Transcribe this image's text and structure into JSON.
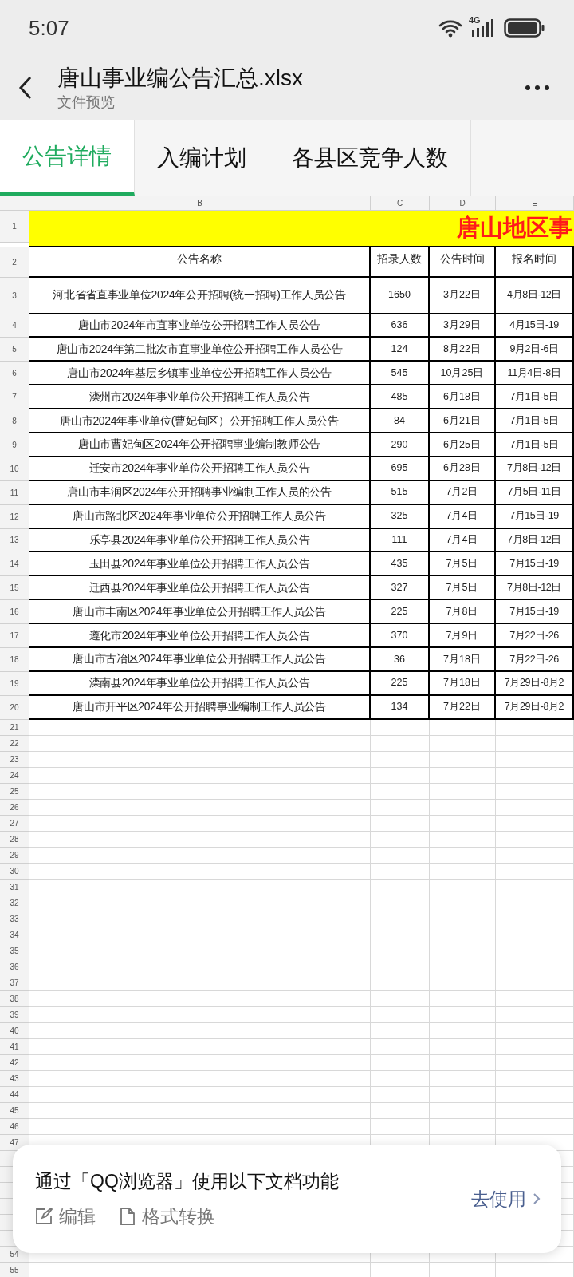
{
  "status_bar": {
    "time": "5:07",
    "network": "4G"
  },
  "header": {
    "title": "唐山事业编公告汇总.xlsx",
    "subtitle": "文件预览"
  },
  "tabs": [
    {
      "label": "公告详情",
      "selected": true
    },
    {
      "label": "入编计划",
      "selected": false
    },
    {
      "label": "各县区竞争人数",
      "selected": false
    }
  ],
  "sheet": {
    "columns": [
      "B",
      "C",
      "D",
      "E"
    ],
    "banner": "唐山地区事",
    "headings": [
      "公告名称",
      "招录人数",
      "公告时间",
      "报名时间"
    ],
    "rows": [
      {
        "number": "3",
        "cells": [
          "河北省省直事业单位2024年公开招聘(统一招聘)工作人员公告",
          "1650",
          "3月22日",
          "4月8日-12日"
        ]
      },
      {
        "number": "4",
        "cells": [
          "唐山市2024年市直事业单位公开招聘工作人员公告",
          "636",
          "3月29日",
          "4月15日-19"
        ]
      },
      {
        "number": "5",
        "cells": [
          "唐山市2024年第二批次市直事业单位公开招聘工作人员公告",
          "124",
          "8月22日",
          "9月2日-6日"
        ]
      },
      {
        "number": "6",
        "cells": [
          "唐山市2024年基层乡镇事业单位公开招聘工作人员公告",
          "545",
          "10月25日",
          "11月4日-8日"
        ]
      },
      {
        "number": "7",
        "cells": [
          "滦州市2024年事业单位公开招聘工作人员公告",
          "485",
          "6月18日",
          "7月1日-5日"
        ]
      },
      {
        "number": "8",
        "cells": [
          "唐山市2024年事业单位(曹妃甸区）公开招聘工作人员公告",
          "84",
          "6月21日",
          "7月1日-5日"
        ]
      },
      {
        "number": "9",
        "cells": [
          "唐山市曹妃甸区2024年公开招聘事业编制教师公告",
          "290",
          "6月25日",
          "7月1日-5日"
        ]
      },
      {
        "number": "10",
        "cells": [
          "迁安市2024年事业单位公开招聘工作人员公告",
          "695",
          "6月28日",
          "7月8日-12日"
        ]
      },
      {
        "number": "11",
        "cells": [
          "唐山市丰润区2024年公开招聘事业编制工作人员的公告",
          "515",
          "7月2日",
          "7月5日-11日"
        ]
      },
      {
        "number": "12",
        "cells": [
          "唐山市路北区2024年事业单位公开招聘工作人员公告",
          "325",
          "7月4日",
          "7月15日-19"
        ]
      },
      {
        "number": "13",
        "cells": [
          "乐亭县2024年事业单位公开招聘工作人员公告",
          "111",
          "7月4日",
          "7月8日-12日"
        ]
      },
      {
        "number": "14",
        "cells": [
          "玉田县2024年事业单位公开招聘工作人员公告",
          "435",
          "7月5日",
          "7月15日-19"
        ]
      },
      {
        "number": "15",
        "cells": [
          "迁西县2024年事业单位公开招聘工作人员公告",
          "327",
          "7月5日",
          "7月8日-12日"
        ]
      },
      {
        "number": "16",
        "cells": [
          "唐山市丰南区2024年事业单位公开招聘工作人员公告",
          "225",
          "7月8日",
          "7月15日-19"
        ]
      },
      {
        "number": "17",
        "cells": [
          "遵化市2024年事业单位公开招聘工作人员公告",
          "370",
          "7月9日",
          "7月22日-26"
        ]
      },
      {
        "number": "18",
        "cells": [
          "唐山市古冶区2024年事业单位公开招聘工作人员公告",
          "36",
          "7月18日",
          "7月22日-26"
        ]
      },
      {
        "number": "19",
        "cells": [
          "滦南县2024年事业单位公开招聘工作人员公告",
          "225",
          "7月18日",
          "7月29日-8月2"
        ]
      },
      {
        "number": "20",
        "cells": [
          "唐山市开平区2024年公开招聘事业编制工作人员公告",
          "134",
          "7月22日",
          "7月29日-8月2"
        ]
      }
    ],
    "top_row_numbers": [
      "1",
      "2"
    ],
    "empty_rows": [
      "21",
      "22",
      "23",
      "24",
      "25",
      "26",
      "27",
      "28",
      "29",
      "30",
      "31",
      "32",
      "33",
      "34",
      "35",
      "36",
      "37",
      "38",
      "39",
      "40",
      "41",
      "42",
      "43",
      "44",
      "45",
      "46",
      "47"
    ],
    "rows_below_popup": [
      "54",
      "55"
    ]
  },
  "popup": {
    "message": "通过「QQ浏览器」使用以下文档功能",
    "actions": [
      "编辑",
      "格式转换"
    ],
    "link": "去使用"
  }
}
